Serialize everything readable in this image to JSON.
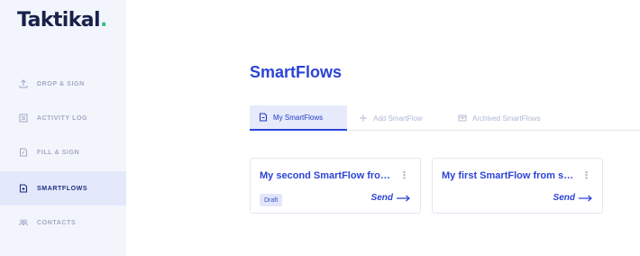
{
  "brand": {
    "name": "Taktikal",
    "dot": ".",
    "accent": "#2ec38e"
  },
  "sidebar": {
    "items": [
      {
        "label": "DROP & SIGN",
        "icon": "upload-icon"
      },
      {
        "label": "ACTIVITY LOG",
        "icon": "list-icon"
      },
      {
        "label": "FILL & SIGN",
        "icon": "form-icon"
      },
      {
        "label": "SMARTFLOWS",
        "icon": "smartflow-icon",
        "active": true
      },
      {
        "label": "CONTACTS",
        "icon": "contacts-icon"
      }
    ]
  },
  "main": {
    "title": "SmartFlows",
    "tabs": [
      {
        "label": "My SmartFlows",
        "icon": "smartflow-icon",
        "active": true
      },
      {
        "label": "Add SmartFlow",
        "icon": "plus-icon"
      },
      {
        "label": "Archived SmartFlows",
        "icon": "archive-icon"
      }
    ],
    "cards": [
      {
        "title": "My second SmartFlow fro…",
        "badge": "Draft",
        "action": "Send"
      },
      {
        "title": "My first SmartFlow from s…",
        "badge": "",
        "action": "Send"
      }
    ]
  },
  "colors": {
    "primary": "#2c44d6",
    "sidebar_bg": "#f3f5fc",
    "active_bg": "#e4e8fb",
    "muted": "#a2a8c3"
  }
}
